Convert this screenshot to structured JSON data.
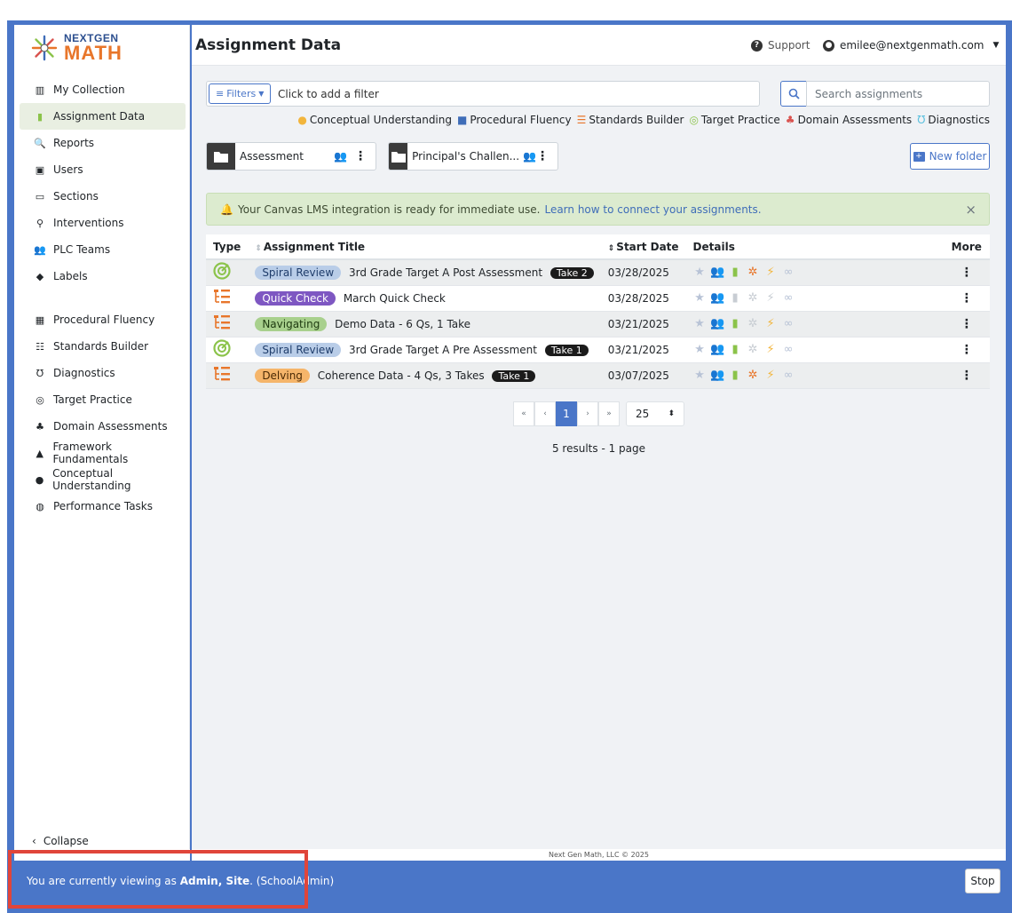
{
  "logo": {
    "line1": "NEXTGEN",
    "line2": "MATH"
  },
  "sidebar": {
    "top_items": [
      {
        "label": "My Collection",
        "icon": "books-icon"
      },
      {
        "label": "Assignment Data",
        "icon": "bar-chart-icon",
        "active": true
      },
      {
        "label": "Reports",
        "icon": "magnify-chart-icon"
      },
      {
        "label": "Users",
        "icon": "id-badge-icon"
      },
      {
        "label": "Sections",
        "icon": "chalkboard-icon"
      },
      {
        "label": "Interventions",
        "icon": "person-chalkboard-icon"
      },
      {
        "label": "PLC Teams",
        "icon": "people-group-icon"
      },
      {
        "label": "Labels",
        "icon": "tag-icon"
      }
    ],
    "bottom_items": [
      {
        "label": "Procedural Fluency",
        "icon": "grid-icon"
      },
      {
        "label": "Standards Builder",
        "icon": "list-tree-icon"
      },
      {
        "label": "Diagnostics",
        "icon": "stethoscope-icon"
      },
      {
        "label": "Target Practice",
        "icon": "target-icon"
      },
      {
        "label": "Domain Assessments",
        "icon": "shapes-icon"
      },
      {
        "label": "Framework Fundamentals",
        "icon": "cubes-icon"
      },
      {
        "label": "Conceptual Understanding",
        "icon": "brain-icon"
      },
      {
        "label": "Performance Tasks",
        "icon": "globe-icon"
      }
    ],
    "collapse_label": "Collapse"
  },
  "header": {
    "title": "Assignment Data",
    "support_label": "Support",
    "user_email": "emilee@nextgenmath.com"
  },
  "filters": {
    "button_label": "Filters",
    "placeholder": "Click to add a filter",
    "search_placeholder": "Search assignments"
  },
  "legend": [
    {
      "label": "Conceptual Understanding",
      "color": "#f2b53c",
      "glyph": "●"
    },
    {
      "label": "Procedural Fluency",
      "color": "#3f6db8",
      "glyph": "■"
    },
    {
      "label": "Standards Builder",
      "color": "#e8762b",
      "glyph": "☰"
    },
    {
      "label": "Target Practice",
      "color": "#8bc34a",
      "glyph": "◎"
    },
    {
      "label": "Domain Assessments",
      "color": "#d9534f",
      "glyph": "♣"
    },
    {
      "label": "Diagnostics",
      "color": "#5bc0de",
      "glyph": "Ʊ"
    }
  ],
  "folders": [
    {
      "label": "Assessment",
      "people_color": "#3f6db8"
    },
    {
      "label": "Principal's Challen...",
      "people_color": "#c0392b"
    }
  ],
  "new_folder_label": "New folder",
  "alert": {
    "text": "Your Canvas LMS integration is ready for immediate use.",
    "link": "Learn how to connect your assignments."
  },
  "table": {
    "headers": {
      "type": "Type",
      "title": "Assignment Title",
      "start": "Start Date",
      "details": "Details",
      "more": "More"
    },
    "rows": [
      {
        "type_icon": "target-icon",
        "type_color": "#8bc34a",
        "badge": "Spiral Review",
        "badge_bg": "#b9cde8",
        "badge_fg": "#1f3d6b",
        "title": "3rd Grade Target A Post Assessment",
        "take": "Take 2",
        "date": "03/28/2025",
        "people_color": "#c0392b",
        "chart_on": true,
        "sync_on": true,
        "bolt_on": true
      },
      {
        "type_icon": "list-tree-icon",
        "type_color": "#e8762b",
        "badge": "Quick Check",
        "badge_bg": "#7e57c2",
        "badge_fg": "#ffffff",
        "title": "March Quick Check",
        "take": "",
        "date": "03/28/2025",
        "people_color": "#8bc34a",
        "chart_on": false,
        "sync_on": false,
        "bolt_on": false
      },
      {
        "type_icon": "list-tree-icon",
        "type_color": "#e8762b",
        "badge": "Navigating",
        "badge_bg": "#a8d08d",
        "badge_fg": "#1e3a10",
        "title": "Demo Data - 6 Qs, 1 Take",
        "take": "",
        "date": "03/21/2025",
        "people_color": "#3f6db8",
        "chart_on": true,
        "sync_on": false,
        "bolt_on": true
      },
      {
        "type_icon": "target-icon",
        "type_color": "#8bc34a",
        "badge": "Spiral Review",
        "badge_bg": "#b9cde8",
        "badge_fg": "#1f3d6b",
        "title": "3rd Grade Target A Pre Assessment",
        "take": "Take 1",
        "date": "03/21/2025",
        "people_color": "#c0392b",
        "chart_on": true,
        "sync_on": false,
        "bolt_on": true
      },
      {
        "type_icon": "list-tree-icon",
        "type_color": "#e8762b",
        "badge": "Delving",
        "badge_bg": "#f5b56a",
        "badge_fg": "#4a2a05",
        "title": "Coherence Data - 4 Qs, 3 Takes",
        "take": "Take 1",
        "date": "03/07/2025",
        "people_color": "#3f6db8",
        "chart_on": true,
        "sync_on": true,
        "bolt_on": true
      }
    ]
  },
  "pagination": {
    "first": "«",
    "prev": "‹",
    "current": "1",
    "next": "›",
    "last": "»",
    "page_size": "25",
    "results": "5 results - 1 page"
  },
  "footer": "Next Gen Math, LLC © 2025",
  "impersonation": {
    "prefix": "You are currently viewing as ",
    "name": "Admin, Site",
    "suffix": ". (SchoolAdmin)",
    "stop_label": "Stop"
  }
}
